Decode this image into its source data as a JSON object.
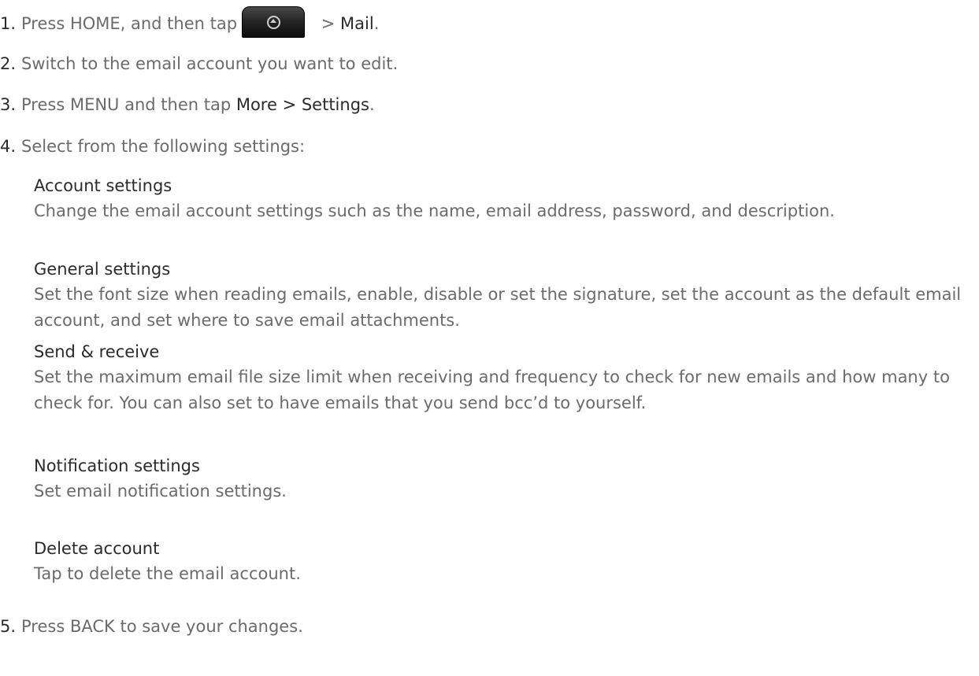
{
  "steps": [
    {
      "num": "1.",
      "text_before": "Press HOME, and then tap",
      "separator": " > ",
      "link": "Mail",
      "after": "."
    },
    {
      "num": "2.",
      "text": "Switch to the email account you want to edit."
    },
    {
      "num": "3.",
      "text_before": "Press MENU and then tap ",
      "link": "More > Settings",
      "after": "."
    },
    {
      "num": "4.",
      "text": "Select from the following settings:"
    },
    {
      "num": "5.",
      "text": "Press BACK to save your changes."
    }
  ],
  "settings": [
    {
      "title": "Account settings",
      "description": "Change the email account settings such as the name, email address, password, and description."
    },
    {
      "title": "General settings",
      "description": "Set the font size when reading emails, enable, disable or set the signature, set the account as the default email account, and set where to save email attachments."
    },
    {
      "title": "Send & receive",
      "description": "Set the maximum email file size limit when receiving and frequency to check for new emails and how many to check for. You can also set to have emails that you send bcc’d to yourself."
    },
    {
      "title": "Notification settings",
      "description": "Set email notification settings."
    },
    {
      "title": "Delete account",
      "description": "Tap to delete the email account."
    }
  ],
  "icons": {
    "home_button": "all-apps-launcher-icon"
  }
}
